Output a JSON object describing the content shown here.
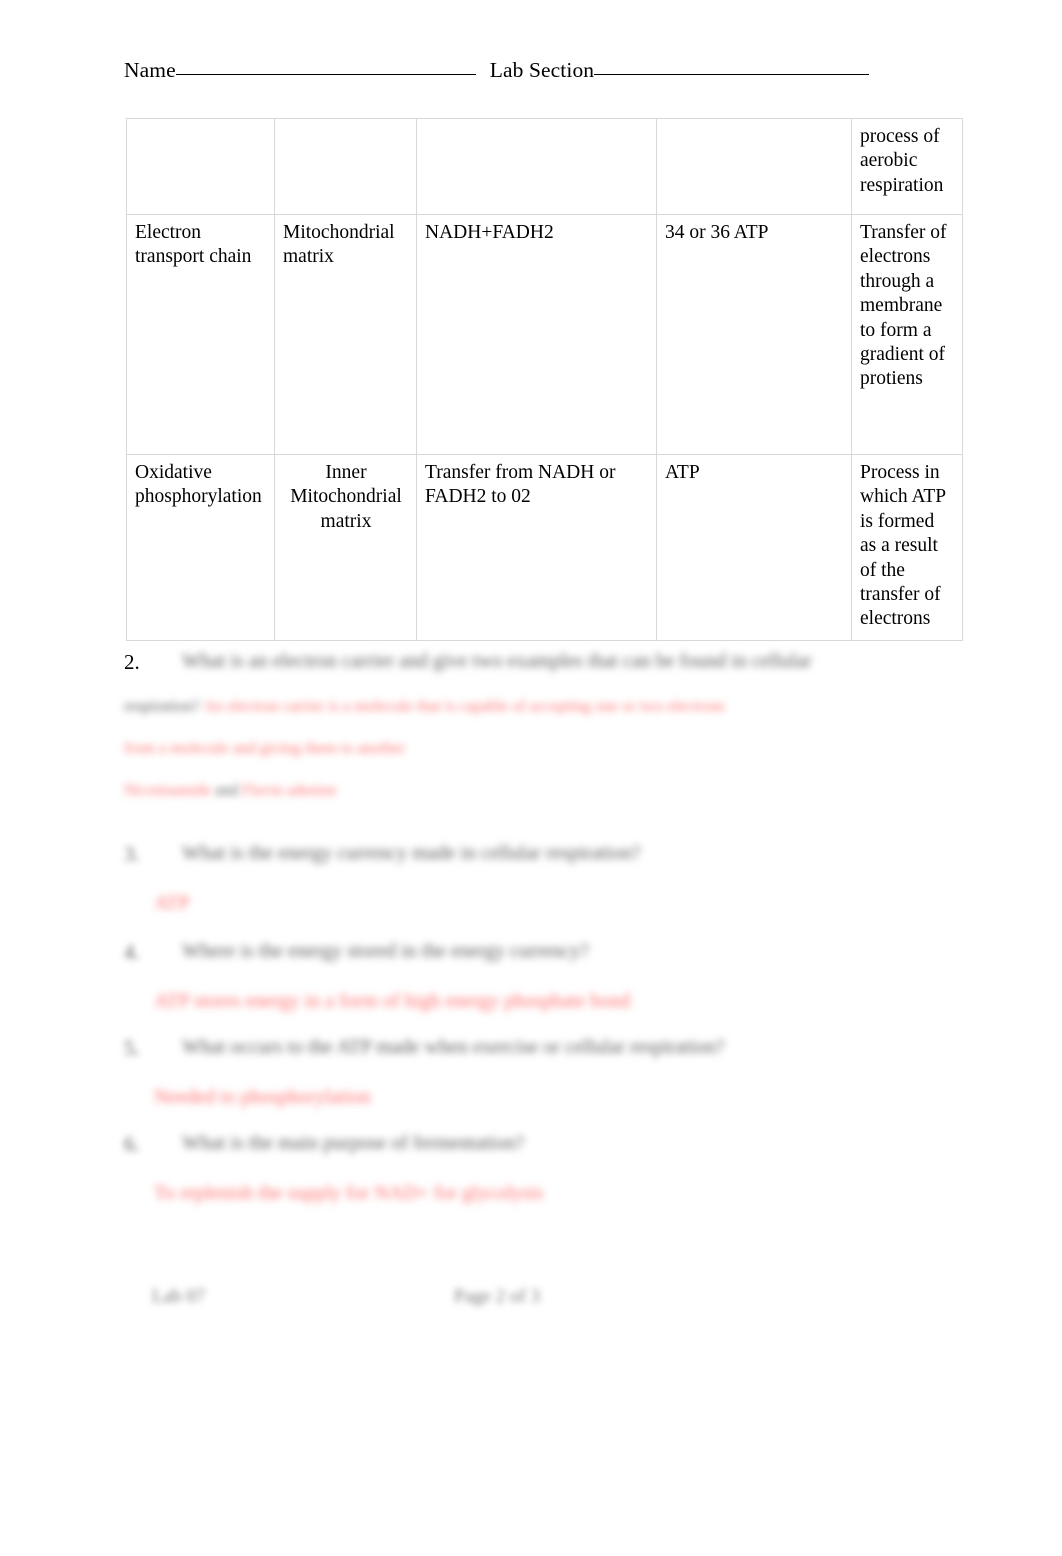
{
  "header": {
    "name_label": "Name",
    "lab_section_label": "Lab Section"
  },
  "table": {
    "rows": [
      {
        "process": "",
        "location": "",
        "reactants": "",
        "products": "",
        "description": "process of aerobic respiration"
      },
      {
        "process": "Electron transport chain",
        "location": "Mitochondrial matrix",
        "reactants": "NADH+FADH2",
        "products": "34 or 36 ATP",
        "description": "Transfer of electrons through a membrane to form a gradient of protiens"
      },
      {
        "process": "Oxidative phosphorylation",
        "location": "Inner Mitochondrial matrix",
        "reactants": "Transfer from NADH or FADH2 to 02",
        "products": "ATP",
        "description": "Process in which ATP is formed as a result of the transfer of electrons"
      }
    ]
  },
  "questions": [
    {
      "number": "2.",
      "prompt": "What is an electron carrier and give two examples that can be found in cellular",
      "prompt_cont": "respiration?",
      "answer_line1": "An electron carrier is a molecule that is capable of accepting one or two electrons",
      "answer_line2": "from a molecule and giving them to another",
      "answer_line3a": "Nicotinamide",
      "answer_line3_and": "and",
      "answer_line3b": "Flavin adenine"
    },
    {
      "number": "3.",
      "prompt": "What is the energy currency made in cellular respiration?",
      "answer": "ATP"
    },
    {
      "number": "4.",
      "prompt": "Where is the energy stored in the energy currency?",
      "answer": "ATP stores energy in a form of high energy phosphate bond"
    },
    {
      "number": "5.",
      "prompt": "What occurs to the ATP made when exercise or cellular respiration?",
      "answer": "Needed to phosphorylation"
    },
    {
      "number": "6.",
      "prompt": "What is the main purpose of fermentation?",
      "answer": "To replenish the supply for NAD+ for glycolysis"
    }
  ],
  "footer": {
    "left": "Lab 07",
    "right": "Page 2 of 3"
  }
}
